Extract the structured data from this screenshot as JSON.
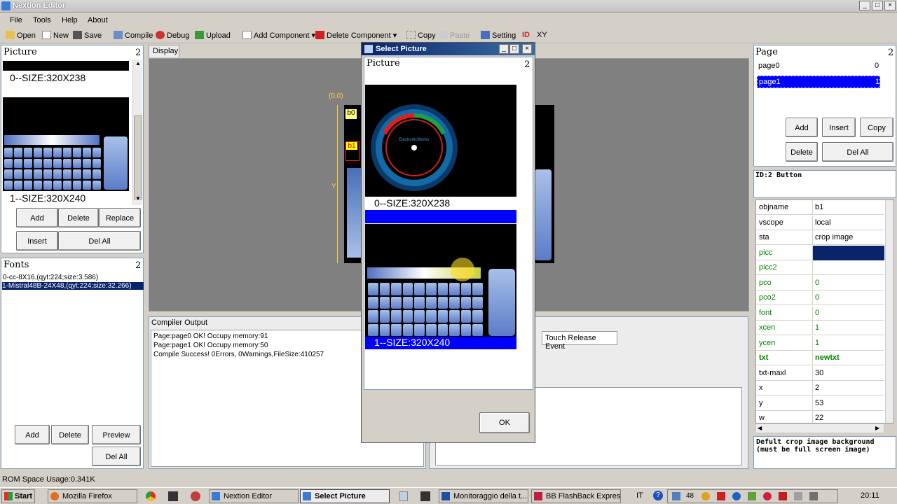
{
  "window": {
    "title": "Nextion Editor"
  },
  "menu": [
    "File",
    "Tools",
    "Help",
    "About"
  ],
  "toolbar": {
    "open": "Open",
    "new": "New",
    "save": "Save",
    "compile": "Compile",
    "debug": "Debug",
    "upload": "Upload",
    "add_component": "Add Component",
    "delete_component": "Delete Component",
    "copy": "Copy",
    "paste": "Paste",
    "setting": "Setting",
    "id": "ID",
    "xy": "XY"
  },
  "picture_panel": {
    "title": "Picture",
    "count": "2",
    "items": [
      "0--SIZE:320X238",
      "1--SIZE:320X240"
    ],
    "buttons": {
      "add": "Add",
      "delete": "Delete",
      "replace": "Replace",
      "insert": "Insert",
      "del_all": "Del All"
    }
  },
  "fonts_panel": {
    "title": "Fonts",
    "count": "2",
    "items": [
      "0-cc-8X16,(qyt:224;size:3.586)",
      "1-Mistral48B-24X48,(qyt:224;size:32.266)"
    ],
    "buttons": {
      "add": "Add",
      "delete": "Delete",
      "preview": "Preview",
      "del_all": "Del All"
    }
  },
  "display": {
    "tab": "Display",
    "origin": "(0,0)",
    "y_axis": "Y",
    "b0": "b0",
    "b1": "b1"
  },
  "compiler": {
    "title": "Compiler Output",
    "lines": [
      "Page:page0 OK! Occupy memory:91",
      "Page:page1 OK! Occupy memory:50",
      "Compile Success! 0Errors, 0Warnings,FileSize:410257"
    ]
  },
  "event_tab": "Touch Release Event",
  "page_panel": {
    "title": "Page",
    "count": "2",
    "items": [
      {
        "name": "page0",
        "id": "0"
      },
      {
        "name": "page1",
        "id": "1"
      }
    ],
    "buttons": {
      "add": "Add",
      "insert": "Insert",
      "copy": "Copy",
      "delete": "Delete",
      "del_all": "Del All"
    }
  },
  "attributes": {
    "header": "ID:2 Button",
    "rows": [
      {
        "key": "objname",
        "value": "b1",
        "color": "#000000"
      },
      {
        "key": "vscope",
        "value": "local",
        "color": "#000000"
      },
      {
        "key": "sta",
        "value": "crop image",
        "color": "#000000"
      },
      {
        "key": "picc",
        "value": "",
        "color": "#008000"
      },
      {
        "key": "picc2",
        "value": "",
        "color": "#008000"
      },
      {
        "key": "pco",
        "value": "0",
        "color": "#008000"
      },
      {
        "key": "pco2",
        "value": "0",
        "color": "#008000"
      },
      {
        "key": "font",
        "value": "0",
        "color": "#008000"
      },
      {
        "key": "xcen",
        "value": "1",
        "color": "#008000"
      },
      {
        "key": "ycen",
        "value": "1",
        "color": "#008000"
      },
      {
        "key": "txt",
        "value": "newtxt",
        "color": "#008000"
      },
      {
        "key": "txt-maxl",
        "value": "30",
        "color": "#000000"
      },
      {
        "key": "x",
        "value": "2",
        "color": "#000000"
      },
      {
        "key": "y",
        "value": "53",
        "color": "#000000"
      },
      {
        "key": "w",
        "value": "22",
        "color": "#000000"
      }
    ],
    "help": "Defult crop image background (must be full screen image)"
  },
  "dialog": {
    "title": "Select Picture",
    "header": "Picture",
    "count": "2",
    "items": [
      "0--SIZE:320X238",
      "1--SIZE:320X240"
    ],
    "gauge_label": "ElectronicWorks",
    "ok": "OK"
  },
  "status": {
    "rom": "ROM Space Usage:0.341K"
  },
  "taskbar": {
    "start": "Start",
    "items": [
      "Mozilla Firefox",
      "Nextion Editor",
      "Select Picture",
      "Monitoraggio della t...",
      "BB FlashBack Expres..."
    ],
    "lang": "IT",
    "tray_num": "48",
    "clock": "20:11"
  },
  "colors": {
    "selection": "#0000ff",
    "accent": "#316ac5"
  }
}
